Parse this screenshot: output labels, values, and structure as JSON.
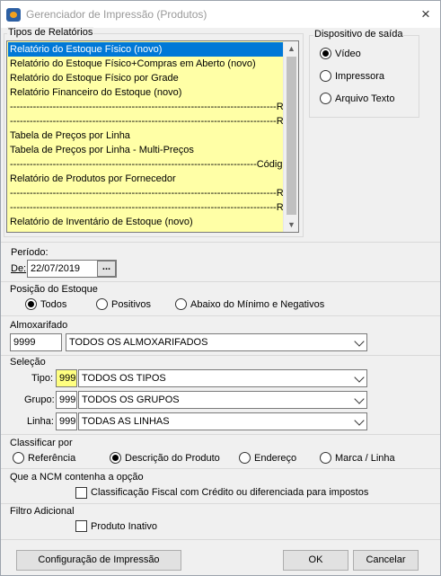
{
  "window": {
    "title": "Gerenciador de Impressão (Produtos)",
    "close_icon": "×"
  },
  "report_types": {
    "label": "Tipos de Relatórios",
    "items": [
      "Relatório do Estoque Físico (novo)",
      "Relatório do Estoque Físico+Compras em Aberto (novo)",
      "Relatório do Estoque Físico por Grade",
      "Relatório Financeiro do Estoque (novo)",
      "---------------------------------------------------------------------------------Rel.Fí",
      "---------------------------------------------------------------------------------Rel.di",
      "Tabela de Preços por Linha",
      "Tabela de Preços por Linha - Multi-Preços",
      "---------------------------------------------------------------------------Códig",
      "Relatório de Produtos por Fornecedor",
      "---------------------------------------------------------------------------------Rel.Di",
      "---------------------------------------------------------------------------------Rel.pr",
      "Relatório de Inventário de Estoque (novo)"
    ],
    "selected_index": 0,
    "scroll_up_icon": "▲",
    "scroll_down_icon": "▼"
  },
  "output_device": {
    "label": "Dispositivo de saída",
    "options": [
      "Vídeo",
      "Impressora",
      "Arquivo Texto"
    ],
    "selected": "Vídeo"
  },
  "period": {
    "label": "Período:",
    "from_label": "De:",
    "date": "22/07/2019",
    "picker_label": "..."
  },
  "stock_position": {
    "label": "Posição do Estoque",
    "options": [
      "Todos",
      "Positivos",
      "Abaixo do Mínimo e Negativos"
    ],
    "selected": "Todos"
  },
  "warehouse": {
    "label": "Almoxarifado",
    "code": "9999",
    "name": "TODOS OS ALMOXARIFADOS"
  },
  "selection": {
    "label": "Seleção",
    "type_label": "Tipo:",
    "type_code": "999",
    "type_name": "TODOS OS TIPOS",
    "group_label": "Grupo:",
    "group_code": "999",
    "group_name": "TODOS OS GRUPOS",
    "line_label": "Linha:",
    "line_code": "999",
    "line_name": "TODAS AS LINHAS"
  },
  "sort_by": {
    "label": "Classificar por",
    "options": [
      "Referência",
      "Descrição do Produto",
      "Endereço",
      "Marca / Linha"
    ],
    "selected": "Descrição do Produto"
  },
  "ncm": {
    "label": "Que a NCM contenha a opção",
    "checkbox_label": "Classificação Fiscal com Crédito ou diferenciada para impostos",
    "checked": false
  },
  "extra_filter": {
    "label": "Filtro Adicional",
    "checkbox_label": "Produto Inativo",
    "checked": false
  },
  "buttons": {
    "print_config": "Configuração de Impressão",
    "ok": "OK",
    "cancel": "Cancelar"
  }
}
